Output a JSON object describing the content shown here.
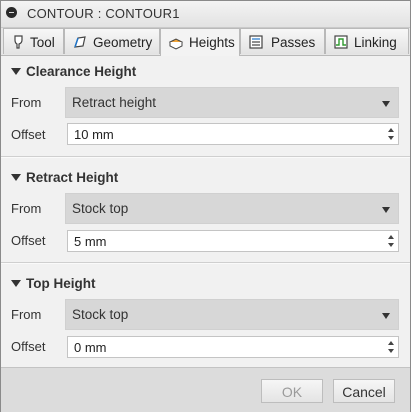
{
  "window": {
    "title": "CONTOUR : CONTOUR1"
  },
  "tabs": [
    {
      "label": "Tool",
      "icon": "tool-icon"
    },
    {
      "label": "Geometry",
      "icon": "geometry-icon"
    },
    {
      "label": "Heights",
      "icon": "heights-icon",
      "active": true
    },
    {
      "label": "Passes",
      "icon": "passes-icon"
    },
    {
      "label": "Linking",
      "icon": "linking-icon"
    }
  ],
  "sections": [
    {
      "title": "Clearance Height",
      "from_label": "From",
      "from_value": "Retract height",
      "offset_label": "Offset",
      "offset_value": "10 mm"
    },
    {
      "title": "Retract Height",
      "from_label": "From",
      "from_value": "Stock top",
      "offset_label": "Offset",
      "offset_value": "5 mm"
    },
    {
      "title": "Top Height",
      "from_label": "From",
      "from_value": "Stock top",
      "offset_label": "Offset",
      "offset_value": "0 mm"
    }
  ],
  "buttons": {
    "ok": "OK",
    "cancel": "Cancel"
  },
  "colors": {
    "select_bg": "#d7d7d7",
    "dialog_bg": "#f1f1f1",
    "ok_disabled_text": "#9a9a9a"
  }
}
